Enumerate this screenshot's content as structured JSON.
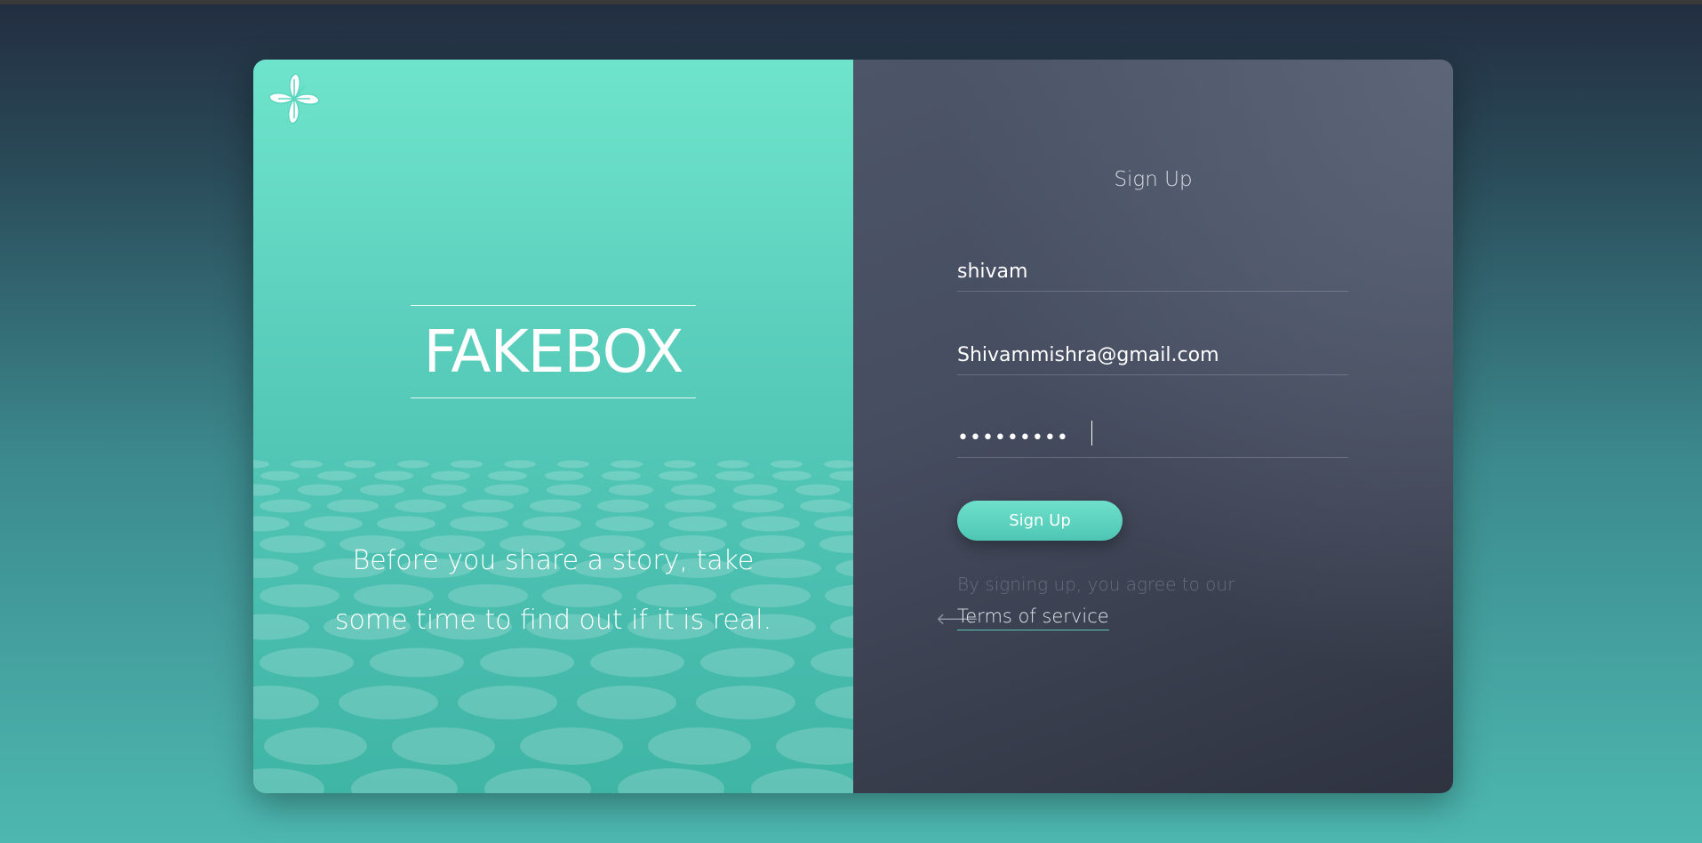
{
  "brand": {
    "name": "FAKEBOX",
    "tagline_line1": "Before you share a story, take",
    "tagline_line2": "some time to find out if it is real.",
    "logo_icon": "flower-logo-icon",
    "accent_color": "#5cd6c0"
  },
  "form": {
    "title": "Sign Up",
    "username_value": "shivam",
    "email_value": "Shivammishra@gmail.com",
    "password_value": "•••••••••",
    "submit_label": "Sign Up",
    "agree_text": "By signing up, you agree to our",
    "terms_label": "Terms of service",
    "arrow_icon": "arrow-left-icon"
  }
}
